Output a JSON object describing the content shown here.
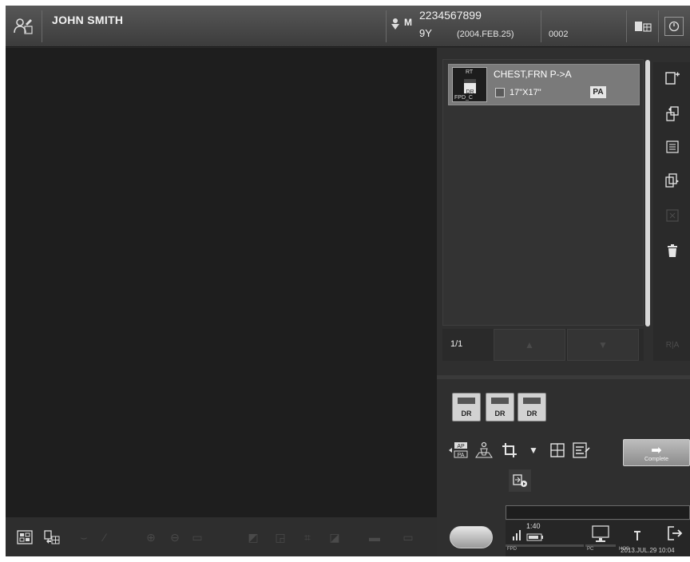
{
  "header": {
    "patient_name": "JOHN SMITH",
    "sex": "M",
    "patient_id": "2234567899",
    "age": "9Y",
    "birth_date": "(2004.FEB.25)",
    "accession": "0002"
  },
  "exam_list": {
    "items": [
      {
        "thumb_top": "RT",
        "thumb_mid": "DR",
        "thumb_bottom": "FPD_C",
        "name": "CHEST,FRN P->A",
        "size": "17\"X17\"",
        "view": "PA"
      }
    ],
    "page": "1/1"
  },
  "detectors": {
    "buttons": [
      "DR",
      "DR",
      "DR"
    ]
  },
  "tools": {
    "complete_label": "Complete",
    "ap_pa_top": "AP",
    "ap_pa_bottom": "PA"
  },
  "status": {
    "fpd_label": "FPD",
    "fpd_value": "1:40",
    "pc_label": "PC",
    "hos_label": "HOS",
    "datetime": "2013.JUL.29 10:04"
  },
  "icons": {
    "accent": "#e6e6e6",
    "disabled": "#4a4a4a"
  }
}
